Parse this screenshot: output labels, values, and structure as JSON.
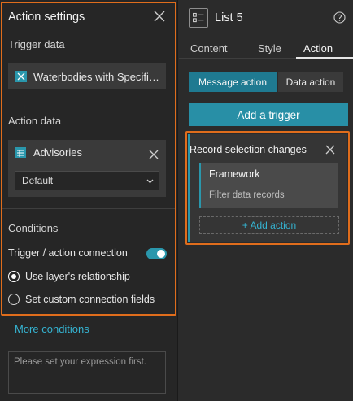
{
  "left_panel": {
    "title": "Action settings",
    "trigger_data_label": "Trigger data",
    "trigger_item": "Waterbodies with Specific…",
    "action_data_label": "Action data",
    "action_item": "Advisories",
    "action_select_value": "Default",
    "conditions_label": "Conditions",
    "toggle_label": "Trigger / action connection",
    "toggle_on": true,
    "radio_options": [
      {
        "label": "Use layer's relationship",
        "selected": true
      },
      {
        "label": "Set custom connection fields",
        "selected": false
      }
    ],
    "more_conditions": "More conditions",
    "expression_placeholder": "Please set your expression first."
  },
  "right_panel": {
    "title": "List 5",
    "tabs": [
      {
        "label": "Content",
        "active": false
      },
      {
        "label": "Style",
        "active": false
      },
      {
        "label": "Action",
        "active": true
      }
    ],
    "segments": [
      {
        "label": "Message action",
        "active": true
      },
      {
        "label": "Data action",
        "active": false
      }
    ],
    "add_trigger": "Add a trigger",
    "card": {
      "title": "Record selection changes",
      "framework_title": "Framework",
      "framework_sub": "Filter data records",
      "add_action": "+ Add action"
    }
  },
  "colors": {
    "accent": "#2a97ac",
    "highlight": "#e06d1c",
    "link": "#35b3d1"
  }
}
